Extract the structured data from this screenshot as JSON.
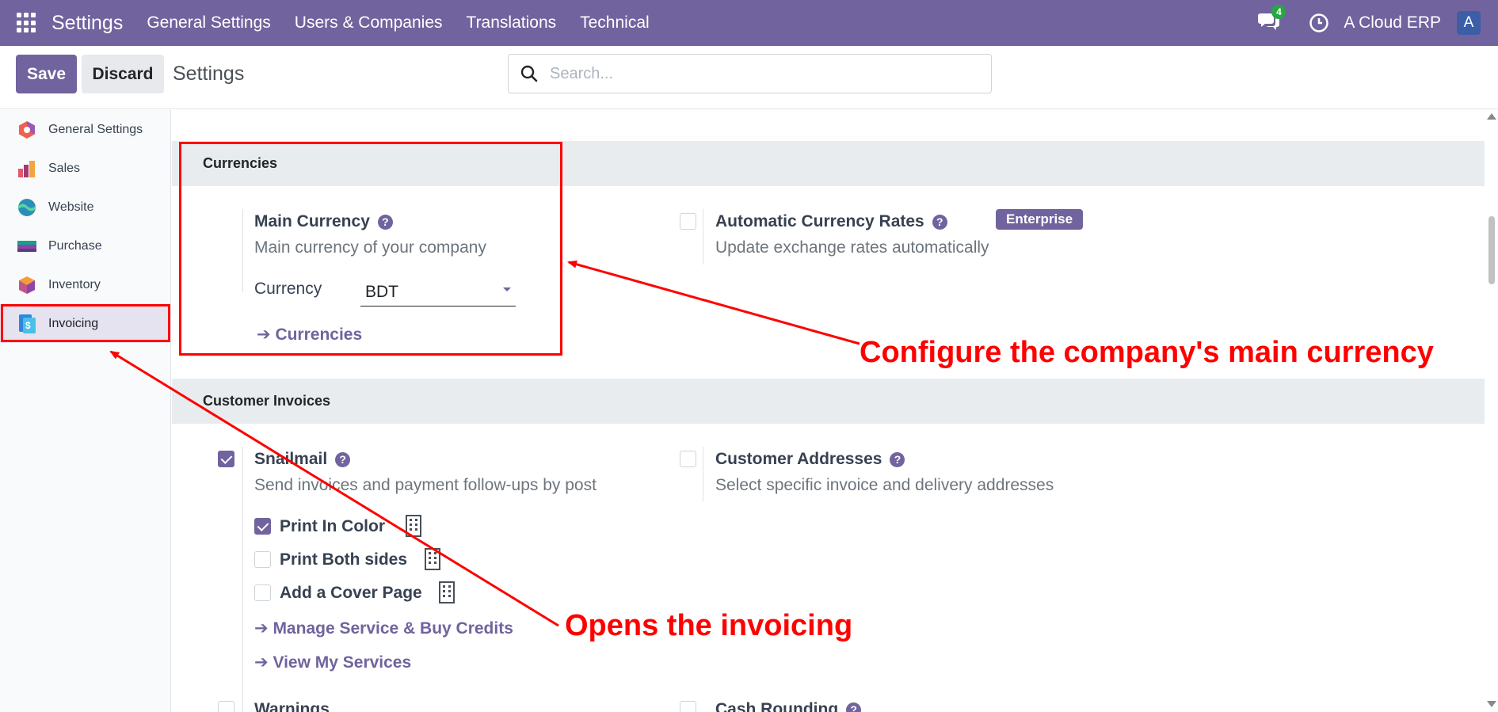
{
  "topbar": {
    "app_name": "Settings",
    "nav": [
      "General Settings",
      "Users & Companies",
      "Translations",
      "Technical"
    ],
    "chat_count": "4",
    "company": "A Cloud ERP",
    "avatar_letter": "A"
  },
  "controls": {
    "save_label": "Save",
    "discard_label": "Discard",
    "title": "Settings",
    "search_placeholder": "Search..."
  },
  "sidebar": {
    "items": [
      {
        "label": "General Settings",
        "icon": "general-settings-icon"
      },
      {
        "label": "Sales",
        "icon": "sales-icon"
      },
      {
        "label": "Website",
        "icon": "website-icon"
      },
      {
        "label": "Purchase",
        "icon": "purchase-icon"
      },
      {
        "label": "Inventory",
        "icon": "inventory-icon"
      },
      {
        "label": "Invoicing",
        "icon": "invoicing-icon",
        "active": true
      }
    ]
  },
  "currencies": {
    "header": "Currencies",
    "main_currency": {
      "title": "Main Currency",
      "desc": "Main currency of your company",
      "field_label": "Currency",
      "value": "BDT",
      "link": "Currencies"
    },
    "auto_rates": {
      "title": "Automatic Currency Rates",
      "badge": "Enterprise",
      "desc": "Update exchange rates automatically",
      "checked": false
    }
  },
  "customer_invoices": {
    "header": "Customer Invoices",
    "snailmail": {
      "title": "Snailmail",
      "desc": "Send invoices and payment follow-ups by post",
      "checked": true,
      "options": [
        {
          "label": "Print In Color",
          "checked": true
        },
        {
          "label": "Print Both sides",
          "checked": false
        },
        {
          "label": "Add a Cover Page",
          "checked": false
        }
      ],
      "links": [
        "Manage Service & Buy Credits",
        "View My Services"
      ]
    },
    "customer_addresses": {
      "title": "Customer Addresses",
      "desc": "Select specific invoice and delivery addresses",
      "checked": false
    },
    "warnings": {
      "title": "Warnings"
    },
    "cash_rounding": {
      "title": "Cash Rounding"
    }
  },
  "annotations": {
    "currency_note": "Configure the company's main currency",
    "invoicing_note": "Opens the invoicing"
  },
  "colors": {
    "brand": "#71639e",
    "annotation": "#ff0000"
  }
}
